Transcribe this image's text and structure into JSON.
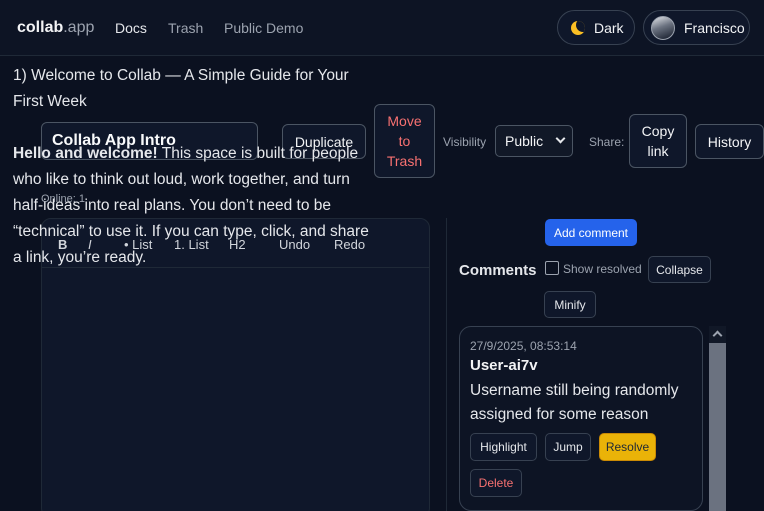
{
  "nav": {
    "brand_main": "collab",
    "brand_suffix": ".app",
    "links": [
      "Docs",
      "Trash",
      "Public Demo"
    ],
    "theme_label": "Dark",
    "theme_icon": "moon-icon",
    "user_name": "Francisco"
  },
  "doc": {
    "title": "Collab App Intro",
    "duplicate_label": "Duplicate",
    "move_to_trash_lines": [
      "Move",
      "to",
      "Trash"
    ],
    "visibility_label": "Visibility",
    "visibility_value": "Public",
    "share_label": "Share:",
    "copy_link_lines": [
      "Copy",
      "link"
    ],
    "history_label": "History",
    "online": "Online: 1"
  },
  "editor": {
    "toolbar": {
      "bold": "B",
      "italic": "I",
      "bullet_list": "• List",
      "numbered_list": "1. List",
      "heading": "H2",
      "undo": "Undo",
      "redo": "Redo"
    },
    "heading_text": "1) Welcome to Collab — A Simple Guide for Your First Week",
    "bold_intro": "Hello and welcome!",
    "intro_rest": " This space is built for people who like to think out loud, work together, and turn half-ideas into real plans. You don’t need to be “technical” to use it. If you can type, click, and share a link, you’re ready."
  },
  "comments": {
    "add_comment": "Add comment",
    "title": "Comments",
    "show_resolved": "Show resolved",
    "collapse": "Collapse",
    "minify": "Minify",
    "items": [
      {
        "timestamp": "27/9/2025, 08:53:14",
        "user": "User-ai7v",
        "text": "Username still being randomly assigned for some reason",
        "highlight": "Highlight",
        "jump": "Jump",
        "resolve": "Resolve",
        "delete": "Delete"
      }
    ]
  },
  "colors": {
    "background": "#0b1120",
    "accent_blue": "#2563eb",
    "resolve_yellow": "#eab308",
    "danger_red": "#f87171"
  }
}
